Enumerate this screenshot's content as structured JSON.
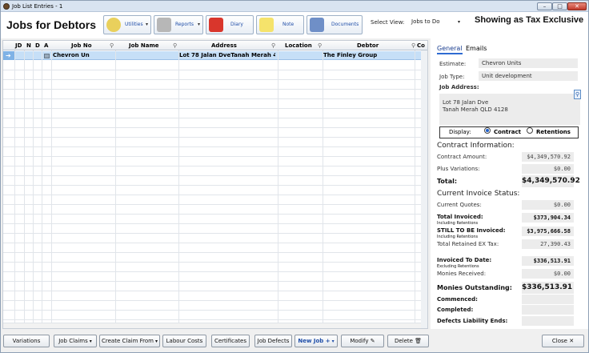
{
  "window": {
    "title": "Job List Entries - 1"
  },
  "header": {
    "page_title": "Jobs for Debtors",
    "toolbar": [
      {
        "label": "Utilities",
        "icon": "utilities-icon",
        "has_menu": true
      },
      {
        "label": "Reports",
        "icon": "reports-icon",
        "has_menu": true
      },
      {
        "label": "Diary",
        "icon": "diary-icon",
        "has_menu": false
      },
      {
        "label": "Note",
        "icon": "note-icon",
        "has_menu": false
      },
      {
        "label": "Documents",
        "icon": "documents-icon",
        "has_menu": false
      }
    ],
    "select_view_label": "Select View:",
    "select_view_value": "Jobs to Do",
    "tax_status": "Showing as Tax Exclusive"
  },
  "grid": {
    "columns": [
      "JD",
      "N",
      "D",
      "A",
      "Job No",
      "Job Name",
      "Address",
      "Location",
      "Debtor",
      "Co"
    ],
    "rows": [
      {
        "job_no": "Chevron Un",
        "job_name": "",
        "address": "Lot 78 Jalan DveTanah Merah 41:",
        "location": "",
        "debtor": "The Finley Group"
      }
    ]
  },
  "panel": {
    "tabs": [
      "General",
      "Emails"
    ],
    "estimate_label": "Estimate:",
    "estimate_value": "Chevron Units",
    "job_type_label": "Job Type:",
    "job_type_value": "Unit development",
    "job_address_label": "Job Address:",
    "address_line1": "Lot 78 Jalan Dve",
    "address_line2": "Tanah Merah QLD 4128",
    "display_label": "Display:",
    "display_options": [
      "Contract",
      "Retentions"
    ],
    "display_selected": "Contract",
    "contract_heading": "Contract Information:",
    "contract_amount_label": "Contract Amount:",
    "contract_amount": "$4,349,570.92",
    "plus_variations_label": "Plus Variations:",
    "plus_variations": "$0.00",
    "total_label": "Total:",
    "total": "$4,349,570.92",
    "invoice_heading": "Current Invoice Status:",
    "current_quotes_label": "Current Quotes:",
    "current_quotes": "$0.00",
    "total_invoiced_label": "Total Invoiced:",
    "total_invoiced_sub": "Including Retentions",
    "total_invoiced": "$373,904.34",
    "still_to_be_label": "STILL TO BE Invoiced:",
    "still_to_be_sub": "Including Retentions",
    "still_to_be": "$3,975,666.58",
    "retained_label": "Total Retained EX Tax:",
    "retained": "27,390.43",
    "invoiced_to_date_label": "Invoiced To Date:",
    "invoiced_to_date_sub": "Excluding Retentions",
    "invoiced_to_date": "$336,513.91",
    "monies_received_label": "Monies Received:",
    "monies_received": "$0.00",
    "monies_outstanding_label": "Monies Outstanding:",
    "monies_outstanding": "$336,513.91",
    "commenced_label": "Commenced:",
    "completed_label": "Completed:",
    "defects_label": "Defects Liability Ends:"
  },
  "bottom": {
    "variations": "Variations",
    "job_claims": "Job Claims",
    "create_claim_from": "Create Claim From",
    "labour_costs": "Labour Costs",
    "certificates": "Certificates",
    "job_defects": "Job Defects",
    "new_job": "New Job",
    "modify": "Modify",
    "delete": "Delete",
    "close": "Close"
  },
  "colors": {
    "selection": "#c6dff7",
    "accent": "#1f4ea8",
    "panel_field": "#ececec"
  }
}
